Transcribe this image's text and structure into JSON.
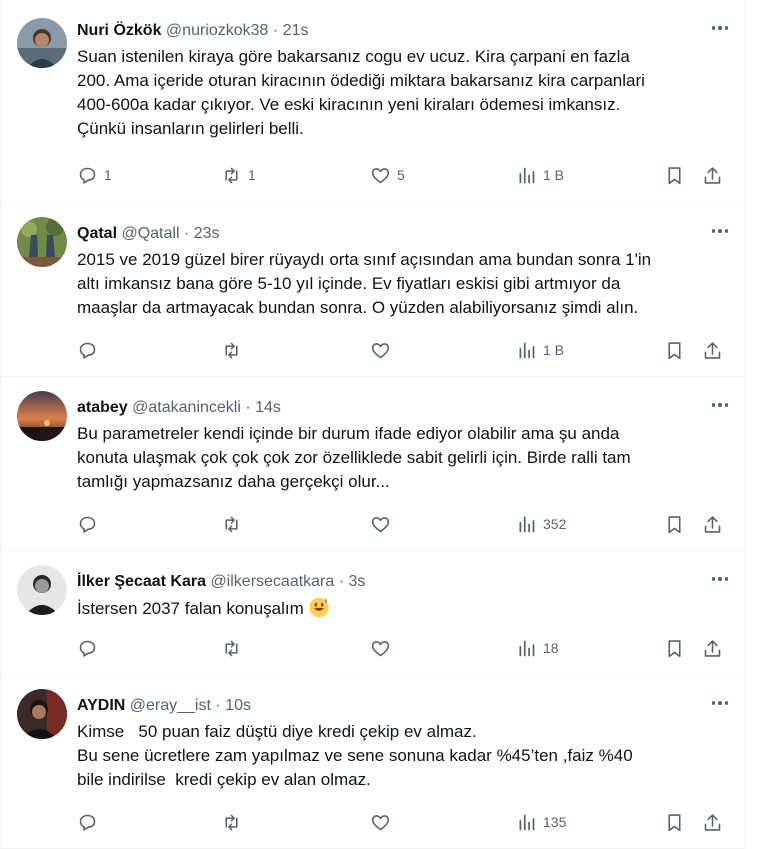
{
  "tweets": [
    {
      "name": "Nuri Özkök",
      "handle": "@nuriozkok38",
      "time": "· 21s",
      "lines": [
        "Suan istenilen kiraya göre bakarsanız cogu ev ucuz. Kira çarpani en fazla",
        "200. Ama içeride oturan kiracının ödediği miktara bakarsanız kira carpanlari",
        "400-600a kadar çıkıyor. Ve eski kiracının yeni kiraları ödemesi imkansız.",
        "Çünkü insanların gelirleri belli."
      ],
      "replies": "1",
      "reposts": "1",
      "likes": "5",
      "views": "1 B"
    },
    {
      "name": "Qatal",
      "handle": "@Qatall",
      "time": "· 23s",
      "lines": [
        "2015 ve 2019 güzel birer rüyaydı orta sınıf açısından ama bundan sonra 1'in",
        "altı imkansız bana göre 5-10 yıl içinde. Ev fiyatları eskisi gibi artmıyor da",
        "maaşlar da artmayacak bundan sonra. O yüzden alabiliyorsanız şimdi alın."
      ],
      "replies": "",
      "reposts": "",
      "likes": "",
      "views": "1 B"
    },
    {
      "name": "atabey",
      "handle": "@atakanincekli",
      "time": "· 14s",
      "lines": [
        "Bu parametreler kendi içinde bir durum ifade ediyor olabilir ama şu anda",
        "konuta ulaşmak çok çok çok zor özellikledе sabit gelirli için. Birde ralli tam",
        "tamlığı yapmazsanız daha gerçekçi olur..."
      ],
      "replies": "",
      "reposts": "",
      "likes": "",
      "views": "352"
    },
    {
      "name": "İlker Şecaat Kara",
      "handle": "@ilkersecaatkara",
      "time": "· 3s",
      "lines": [
        "İstersen 2037 falan konuşalım"
      ],
      "emoji": "grinning-sweat-emoji",
      "replies": "",
      "reposts": "",
      "likes": "",
      "views": "18"
    },
    {
      "name": "AYDIN",
      "handle": "@eray__ist",
      "time": "· 10s",
      "lines": [
        "Kimse   50 puan faiz düştü diye kredi çekip ev almaz.",
        "Bu sene ücretlere zam yapılmaz ve sene sonuna kadar %45’ten ,faiz %40",
        "bile indirilse  kredi çekip ev alan olmaz."
      ],
      "replies": "",
      "reposts": "",
      "likes": "",
      "views": "135"
    }
  ],
  "icons": {
    "reply": "reply-icon",
    "repost": "repost-icon",
    "like": "like-icon",
    "views": "views-icon",
    "bookmark": "bookmark-icon",
    "share": "share-icon",
    "more": "more-icon"
  },
  "colors": {
    "text": "#0f1419",
    "secondary": "#536471",
    "border": "#eff3f4"
  }
}
